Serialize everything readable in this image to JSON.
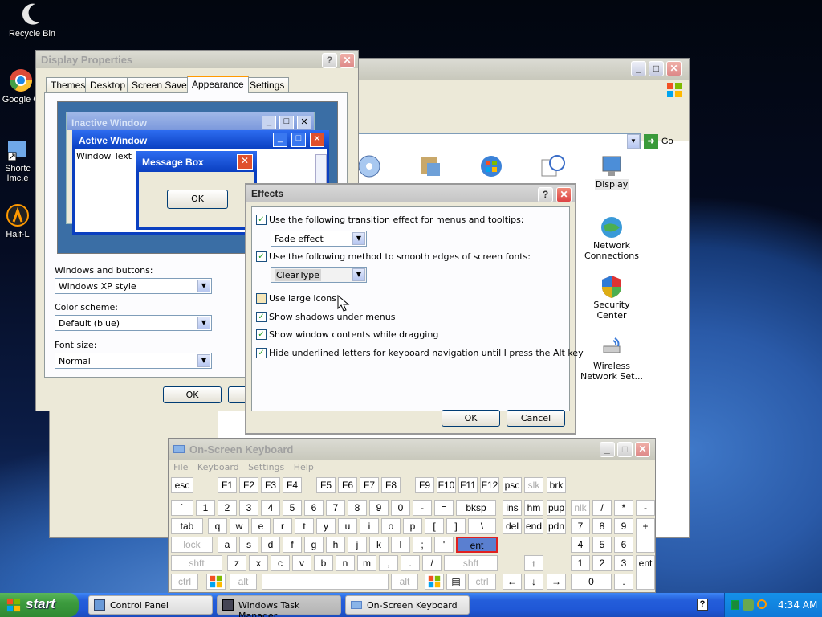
{
  "desktop": {
    "icons": [
      {
        "label": "Recycle Bin"
      },
      {
        "label": "Google C"
      },
      {
        "label": "Shortc Imc.e"
      },
      {
        "label": "Half-L"
      }
    ]
  },
  "control_panel": {
    "go_label": "Go",
    "items": [
      {
        "label": "Display"
      },
      {
        "label": "Network Connections"
      },
      {
        "label": "Security Center"
      },
      {
        "label": "Wireless Network Set..."
      }
    ]
  },
  "display_props": {
    "title": "Display Properties",
    "tabs": [
      "Themes",
      "Desktop",
      "Screen Saver",
      "Appearance",
      "Settings"
    ],
    "selected_tab": "Appearance",
    "preview": {
      "inactive_title": "Inactive Window",
      "active_title": "Active Window",
      "window_text": "Window Text",
      "msgbox_title": "Message Box",
      "msgbox_ok": "OK"
    },
    "windows_buttons_label": "Windows and buttons:",
    "windows_buttons_value": "Windows XP style",
    "color_scheme_label": "Color scheme:",
    "color_scheme_value": "Default (blue)",
    "font_size_label": "Font size:",
    "font_size_value": "Normal",
    "ok_label": "OK"
  },
  "effects": {
    "title": "Effects",
    "transition_label": "Use the following transition effect for menus and tooltips:",
    "transition_value": "Fade effect",
    "smooth_label": "Use the following method to smooth edges of screen fonts:",
    "smooth_value": "ClearType",
    "large_icons": "Use large icons",
    "shadows": "Show shadows under menus",
    "contents_drag": "Show window contents while dragging",
    "underline": "Hide underlined letters for keyboard navigation until I press the Alt key",
    "ok_label": "OK",
    "cancel_label": "Cancel"
  },
  "osk": {
    "title": "On-Screen Keyboard",
    "menu": [
      "File",
      "Keyboard",
      "Settings",
      "Help"
    ],
    "rows": {
      "r1": [
        "esc",
        "F1",
        "F2",
        "F3",
        "F4",
        "F5",
        "F6",
        "F7",
        "F8",
        "F9",
        "F10",
        "F11",
        "F12",
        "psc",
        "slk",
        "brk"
      ],
      "r2": [
        "`",
        "1",
        "2",
        "3",
        "4",
        "5",
        "6",
        "7",
        "8",
        "9",
        "0",
        "-",
        "=",
        "bksp",
        "ins",
        "hm",
        "pup",
        "nlk",
        "/",
        "*",
        "-"
      ],
      "r3": [
        "tab",
        "q",
        "w",
        "e",
        "r",
        "t",
        "y",
        "u",
        "i",
        "o",
        "p",
        "[",
        "]",
        "\\",
        "del",
        "end",
        "pdn",
        "7",
        "8",
        "9",
        "+"
      ],
      "r4": [
        "lock",
        "a",
        "s",
        "d",
        "f",
        "g",
        "h",
        "j",
        "k",
        "l",
        ";",
        "'",
        "ent",
        "4",
        "5",
        "6"
      ],
      "r5": [
        "shft",
        "z",
        "x",
        "c",
        "v",
        "b",
        "n",
        "m",
        ",",
        ".",
        "/",
        "shft",
        "↑",
        "1",
        "2",
        "3",
        "ent"
      ],
      "r6": [
        "ctrl",
        "alt",
        "alt",
        "ctrl",
        "←",
        "↓",
        "→",
        "0",
        "."
      ]
    }
  },
  "taskbar": {
    "start_label": "start",
    "tasks": [
      "Control Panel",
      "Windows Task Manager",
      "On-Screen Keyboard"
    ],
    "clock": "4:34 AM"
  }
}
